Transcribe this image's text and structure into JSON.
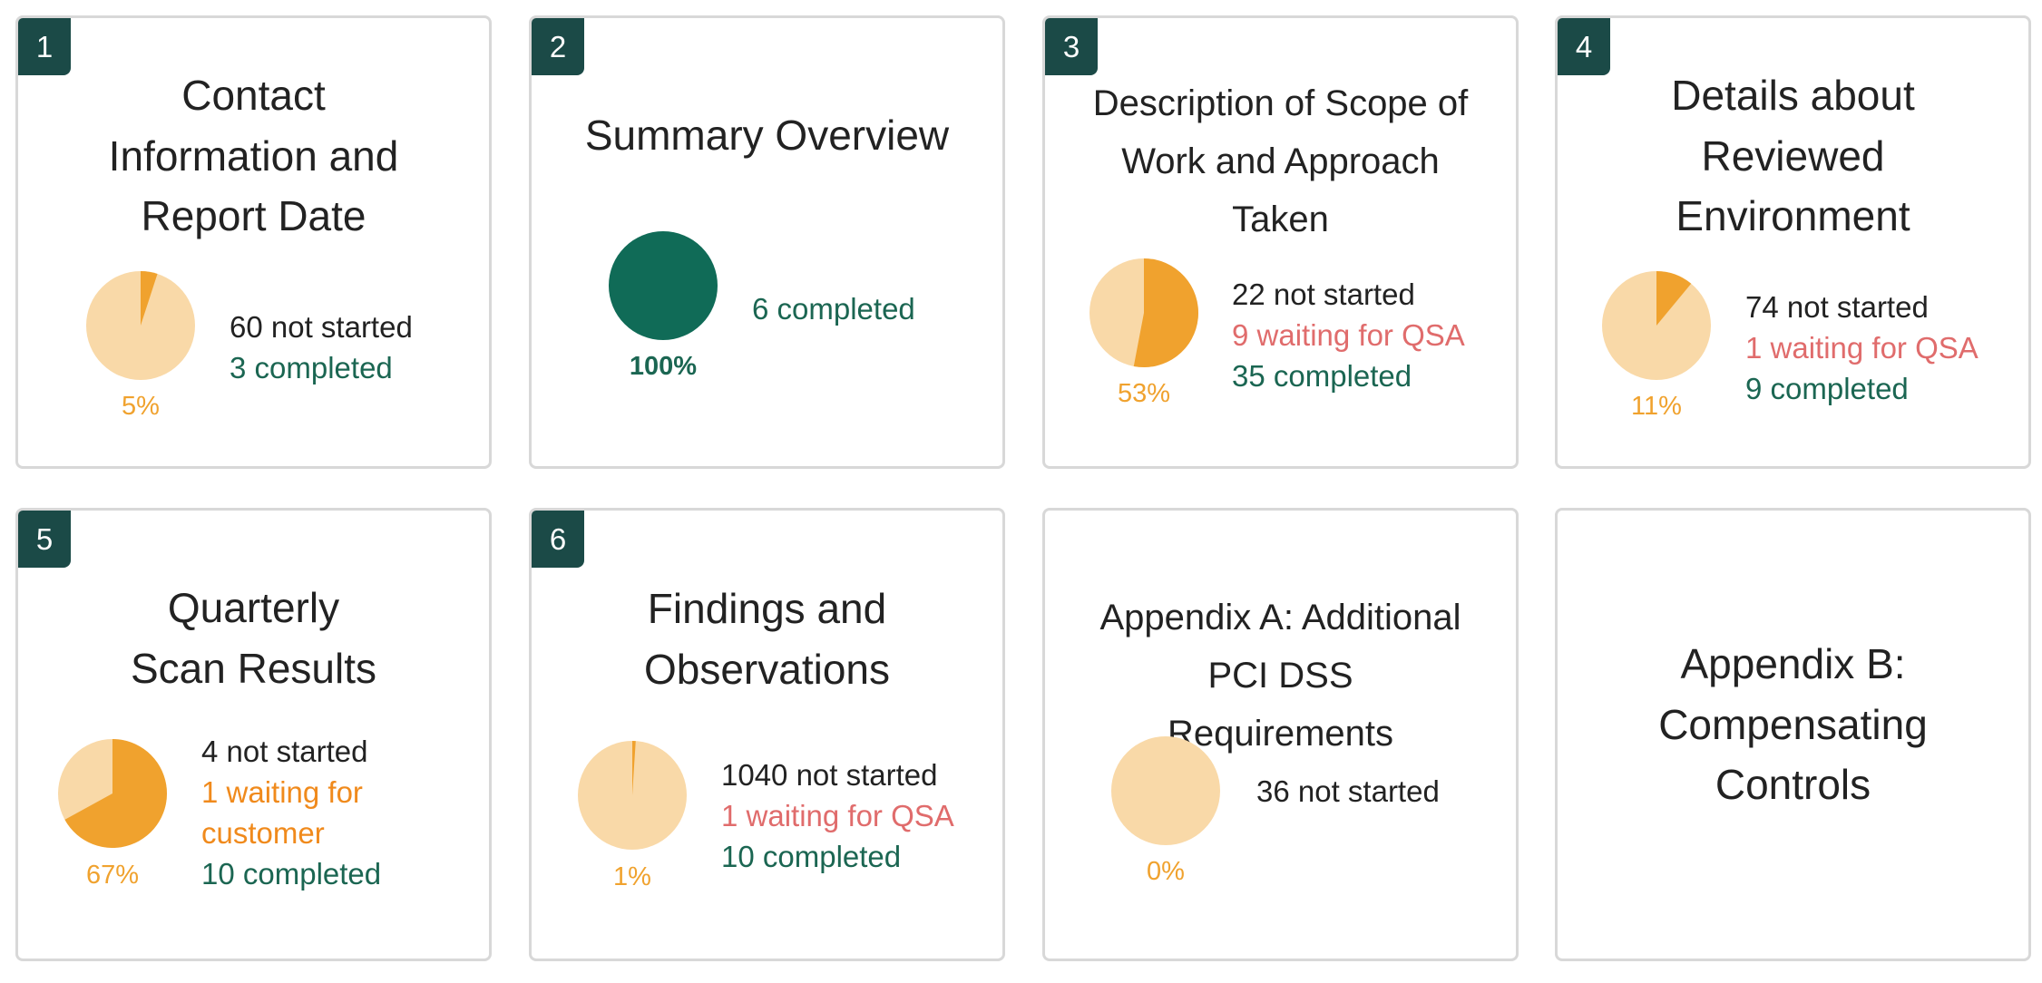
{
  "colors": {
    "badge_bg": "#1b4a47",
    "pie_pending": "#f9d9a8",
    "pie_progress": "#f0a22e",
    "pie_complete": "#106b57",
    "not_started": "#222222",
    "waiting_for_qsa": "#e06c6c",
    "waiting_for_customer": "#f08a1c",
    "completed": "#1b6652"
  },
  "cards": [
    {
      "number": "1",
      "title": "Contact Information and Report Date",
      "progress_fraction": 0.05,
      "percent_label": "5%",
      "stats": {
        "not_started": "60 not started",
        "completed": "3 completed"
      }
    },
    {
      "number": "2",
      "title": "Summary Overview",
      "progress_fraction": 1.0,
      "percent_label": "100%",
      "stats": {
        "completed": "6 completed"
      }
    },
    {
      "number": "3",
      "title": "Description of Scope of Work and Approach Taken",
      "progress_fraction": 0.53,
      "percent_label": "53%",
      "stats": {
        "not_started": "22 not started",
        "waiting_qsa": "9 waiting for QSA",
        "completed": "35 completed"
      }
    },
    {
      "number": "4",
      "title": "Details about Reviewed Environment",
      "progress_fraction": 0.11,
      "percent_label": "11%",
      "stats": {
        "not_started": "74 not started",
        "waiting_qsa": "1 waiting for QSA",
        "completed": "9 completed"
      }
    },
    {
      "number": "5",
      "title": "Quarterly Scan Results",
      "progress_fraction": 0.67,
      "percent_label": "67%",
      "stats": {
        "not_started": "4 not started",
        "waiting_customer_1": "1 waiting for",
        "waiting_customer_2": "customer",
        "completed": "10 completed"
      }
    },
    {
      "number": "6",
      "title": "Findings and Observations",
      "progress_fraction": 0.01,
      "percent_label": "1%",
      "stats": {
        "not_started": "1040 not started",
        "waiting_qsa": "1 waiting for QSA",
        "completed": "10 completed"
      }
    },
    {
      "title": "Appendix A: Additional PCI DSS Requirements",
      "progress_fraction": 0.0,
      "percent_label": "0%",
      "stats": {
        "not_started": "36 not started"
      }
    },
    {
      "title": "Appendix B: Compensating Controls"
    }
  ]
}
